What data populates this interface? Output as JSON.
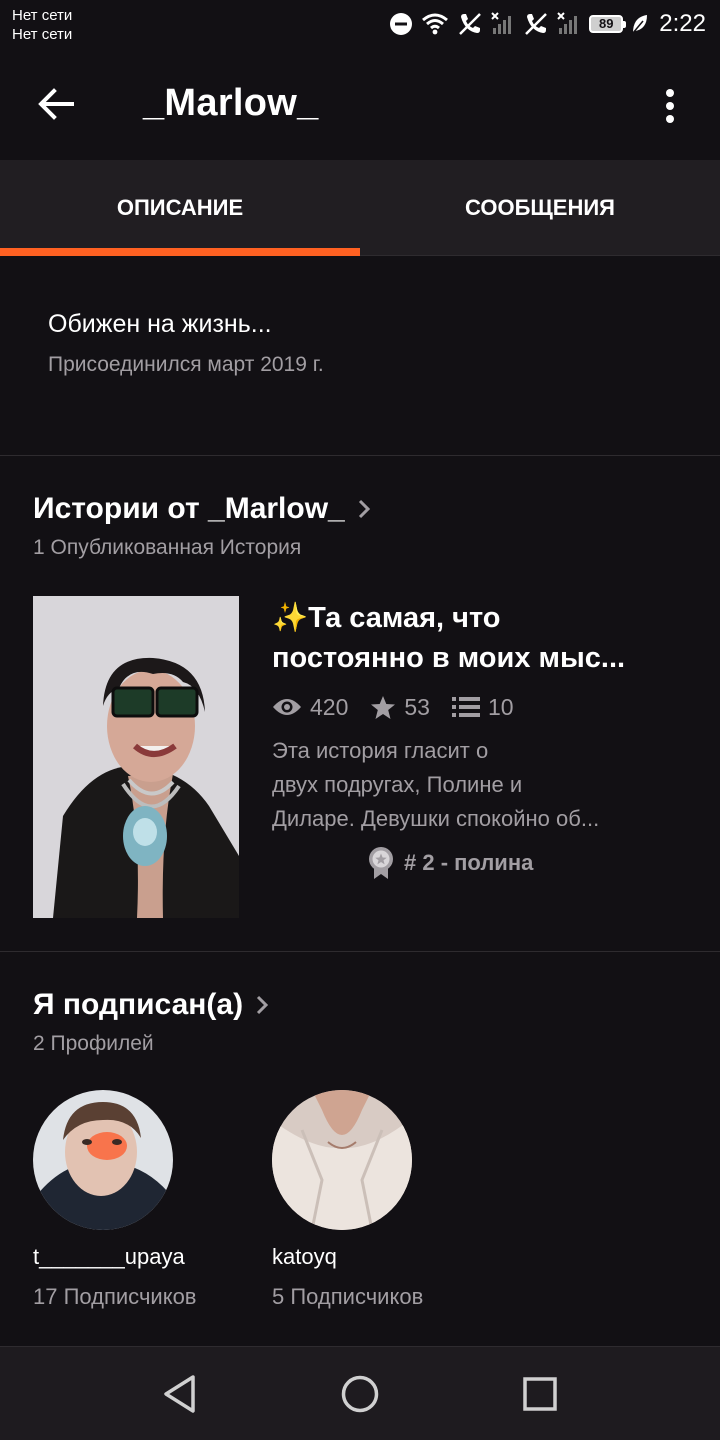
{
  "status_bar": {
    "carrier_line1": "Нет сети",
    "carrier_line2": "Нет сети",
    "battery": "89",
    "time": "2:22"
  },
  "app_bar": {
    "title": "_Marlow_"
  },
  "tabs": [
    {
      "label": "ОПИСАНИЕ",
      "active": true
    },
    {
      "label": "СООБЩЕНИЯ",
      "active": false
    }
  ],
  "accent_color": "#ff6122",
  "about": {
    "tagline": "Обижен на жизнь...",
    "joined": "Присоединился март 2019 г."
  },
  "stories": {
    "title": "Истории от _Marlow_",
    "subtitle": "1 Опубликованная История",
    "items": [
      {
        "title_emoji": "✨",
        "title_line1": "Та самая, что",
        "title_line2": "постоянно в моих мыс...",
        "reads": "420",
        "votes": "53",
        "parts": "10",
        "blurb_line1": "Эта история гласит о",
        "blurb_line2": "двух подругах, Полине и",
        "blurb_line3": "Диларе. Девушки спокойно об...",
        "rank": "# 2 - полина"
      }
    ]
  },
  "following": {
    "title": "Я подписан(а)",
    "subtitle": "2 Профилей",
    "profiles": [
      {
        "username": "t_______upaya",
        "followers": "17 Подписчиков"
      },
      {
        "username": "katoyq",
        "followers": "5 Подписчиков"
      }
    ]
  },
  "icons": {
    "back": "arrow-left-icon",
    "more": "more-vertical-icon",
    "chevron": "chevron-right-icon",
    "reads": "eye-icon",
    "votes": "star-icon",
    "parts": "list-icon",
    "rank": "badge-icon"
  }
}
